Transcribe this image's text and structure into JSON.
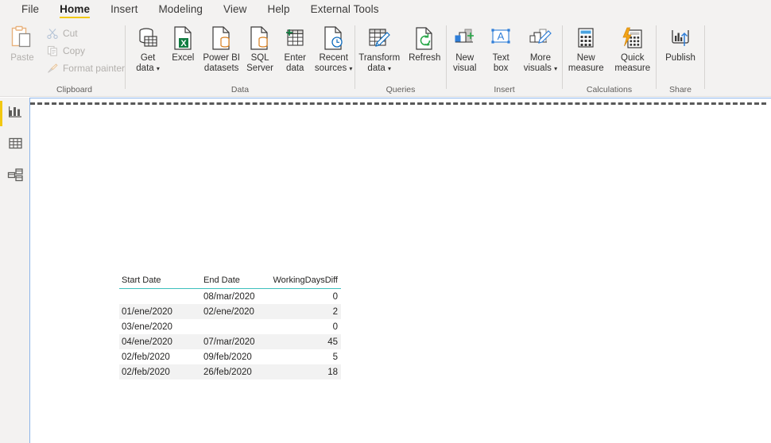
{
  "tabs": [
    {
      "label": "File",
      "active": false
    },
    {
      "label": "Home",
      "active": true
    },
    {
      "label": "Insert",
      "active": false
    },
    {
      "label": "Modeling",
      "active": false
    },
    {
      "label": "View",
      "active": false
    },
    {
      "label": "Help",
      "active": false
    },
    {
      "label": "External Tools",
      "active": false
    }
  ],
  "ribbon": {
    "groups": {
      "clipboard": {
        "label": "Clipboard",
        "paste": "Paste",
        "cut": "Cut",
        "copy": "Copy",
        "format_painter": "Format painter"
      },
      "data": {
        "label": "Data",
        "get_data": "Get\ndata",
        "get_data_l1": "Get",
        "get_data_l2": "data",
        "excel": "Excel",
        "powerbi_l1": "Power BI",
        "powerbi_l2": "datasets",
        "sql_l1": "SQL",
        "sql_l2": "Server",
        "enter_l1": "Enter",
        "enter_l2": "data",
        "recent_l1": "Recent",
        "recent_l2": "sources"
      },
      "queries": {
        "label": "Queries",
        "transform_l1": "Transform",
        "transform_l2": "data",
        "refresh": "Refresh"
      },
      "insert": {
        "label": "Insert",
        "new_visual_l1": "New",
        "new_visual_l2": "visual",
        "text_box_l1": "Text",
        "text_box_l2": "box",
        "more_visuals_l1": "More",
        "more_visuals_l2": "visuals"
      },
      "calculations": {
        "label": "Calculations",
        "new_measure_l1": "New",
        "new_measure_l2": "measure",
        "quick_measure_l1": "Quick",
        "quick_measure_l2": "measure"
      },
      "share": {
        "label": "Share",
        "publish": "Publish"
      }
    }
  },
  "leftnav": {
    "items": [
      {
        "name": "report-view",
        "icon": "bar-chart-icon",
        "active": true
      },
      {
        "name": "data-view",
        "icon": "table-icon",
        "active": false
      },
      {
        "name": "model-view",
        "icon": "model-relationships-icon",
        "active": false
      }
    ]
  },
  "table_visual": {
    "columns": [
      "Start Date",
      "End Date",
      "WorkingDaysDiff"
    ],
    "rows": [
      [
        "",
        "08/mar/2020",
        "0"
      ],
      [
        "01/ene/2020",
        "02/ene/2020",
        "2"
      ],
      [
        "03/ene/2020",
        "",
        "0"
      ],
      [
        "04/ene/2020",
        "07/mar/2020",
        "45"
      ],
      [
        "02/feb/2020",
        "09/feb/2020",
        "5"
      ],
      [
        "02/feb/2020",
        "26/feb/2020",
        "18"
      ]
    ]
  },
  "colors": {
    "accent_yellow": "#f2c811",
    "ribbon_bg": "#f3f2f1",
    "table_header_rule": "#3dc0bd",
    "canvas_border": "#8cb4e8",
    "alt_row": "#f2f2f2"
  }
}
